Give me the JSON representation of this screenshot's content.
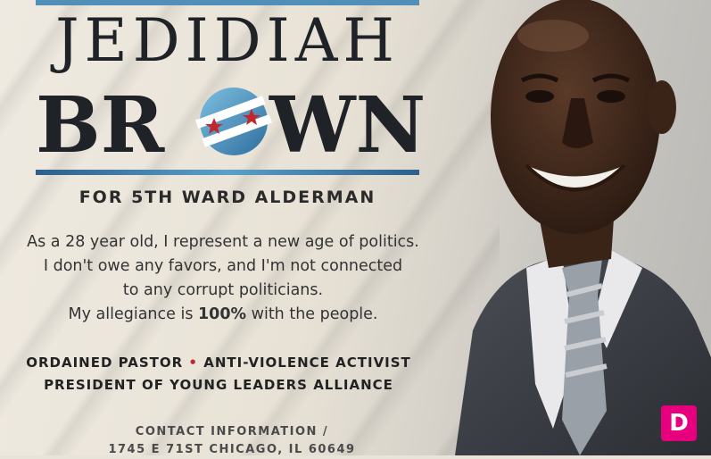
{
  "poster": {
    "first_name": "JEDIDIAH",
    "last_name_start": "BR",
    "last_name_end": "WN",
    "subtitle": "FOR 5TH WARD ALDERMAN",
    "body_line1": "As a 28 year old, I represent a new age of politics.",
    "body_line2": "I don't owe any favors, and I'm not connected",
    "body_line3": "to any corrupt politicians.",
    "body_line4_pre": "My allegiance is ",
    "body_line4_bold": "100%",
    "body_line4_post": " with the people.",
    "cred1": "ORDAINED PASTOR",
    "cred_sep": "•",
    "cred2": "ANTI-VIOLENCE ACTIVIST",
    "cred3": "PRESIDENT OF YOUNG LEADERS ALLIANCE",
    "contact_heading": "CONTACT INFORMATION /",
    "contact_address": "1745 E 71ST CHICAGO, IL 60649"
  },
  "corner_logo": {
    "letter": "D",
    "color": "#e6007e"
  },
  "colors": {
    "accent_blue": "#4f8fb8",
    "dark_text": "#1f2328",
    "red_star": "#c1272d"
  }
}
